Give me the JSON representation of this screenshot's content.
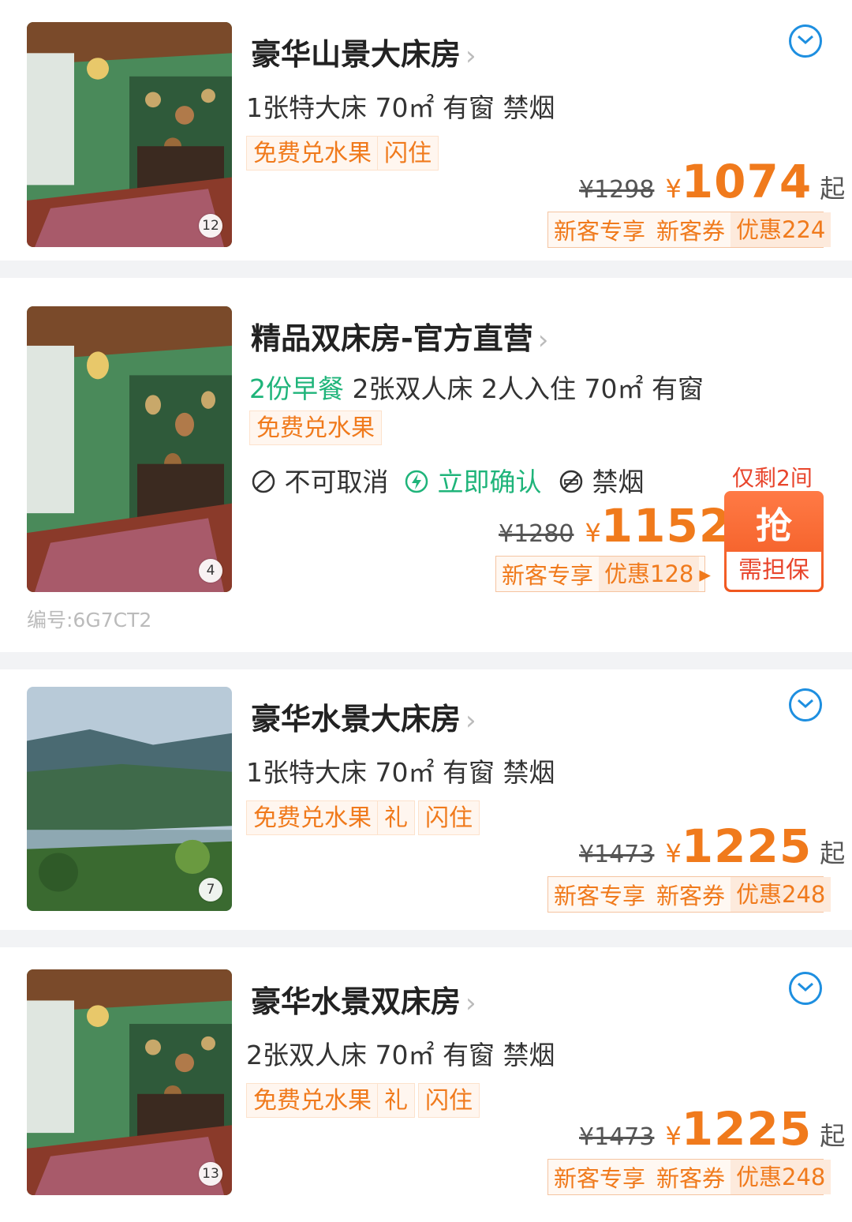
{
  "rooms": [
    {
      "name": "豪华山景大床房",
      "desc": "1张特大床 70㎡ 有窗 禁烟",
      "tags": [
        "免费兑水果",
        "闪住"
      ],
      "photo_count": "12",
      "old_price": "¥1298",
      "currency": "¥",
      "price": "1074",
      "suffix": "起",
      "promo": [
        "新客专享",
        "新客券",
        "优惠224"
      ]
    },
    {
      "name": "精品双床房-官方直营",
      "breakfast": "2份早餐",
      "desc": "2张双人床 2人入住 70㎡ 有窗",
      "tags": [
        "免费兑水果"
      ],
      "photo_count": "4",
      "policies": [
        "不可取消",
        "立即确认",
        "禁烟"
      ],
      "remaining": "仅剩2间",
      "old_price": "¥1280",
      "currency": "¥",
      "price": "1152",
      "promo": [
        "新客专享",
        "优惠128"
      ],
      "promo_arrow": "▸",
      "grab_label": "抢",
      "guarantee_label": "需担保",
      "code": "编号:6G7CT2"
    },
    {
      "name": "豪华水景大床房",
      "desc": "1张特大床 70㎡ 有窗 禁烟",
      "tags": [
        "免费兑水果",
        "礼",
        "闪住"
      ],
      "photo_count": "7",
      "old_price": "¥1473",
      "currency": "¥",
      "price": "1225",
      "suffix": "起",
      "promo": [
        "新客专享",
        "新客券",
        "优惠248"
      ]
    },
    {
      "name": "豪华水景双床房",
      "desc": "2张双人床 70㎡ 有窗 禁烟",
      "tags": [
        "免费兑水果",
        "礼",
        "闪住"
      ],
      "photo_count": "13",
      "old_price": "¥1473",
      "currency": "¥",
      "price": "1225",
      "suffix": "起",
      "promo": [
        "新客专享",
        "新客券",
        "优惠248"
      ]
    }
  ],
  "title_chevron": "›",
  "colors": {
    "accent": "#f07a1c",
    "green": "#1fb47a",
    "blue": "#1e8fe0",
    "red": "#e8452c"
  },
  "icons": [
    "chevron-right-icon",
    "expand-chevron-icon",
    "no-cancel-icon",
    "instant-confirm-icon",
    "no-smoking-icon"
  ]
}
